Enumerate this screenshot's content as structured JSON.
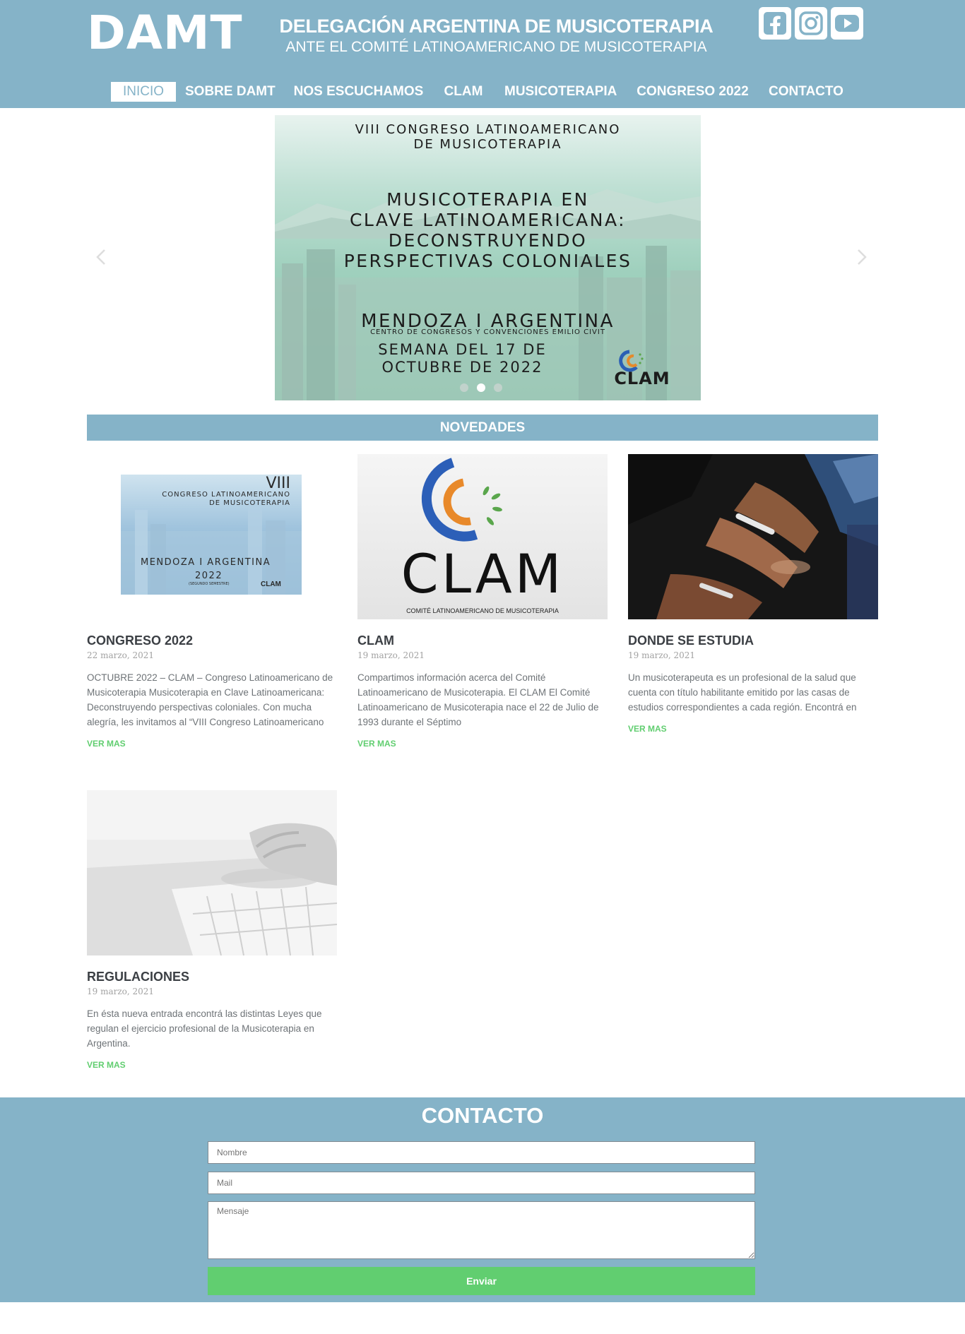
{
  "brand": {
    "logo_text": "DAMT",
    "title": "DELEGACIÓN ARGENTINA DE MUSICOTERAPIA",
    "subtitle": "ANTE EL COMITÉ LATINOAMERICANO DE MUSICOTERAPIA"
  },
  "social": [
    {
      "icon": "facebook-icon"
    },
    {
      "icon": "instagram-icon"
    },
    {
      "icon": "youtube-icon"
    }
  ],
  "nav": {
    "items": [
      {
        "label": "INICIO",
        "active": true
      },
      {
        "label": "SOBRE DAMT"
      },
      {
        "label": "NOS ESCUCHAMOS"
      },
      {
        "label": "CLAM"
      },
      {
        "label": "MUSICOTERAPIA"
      },
      {
        "label": "CONGRESO 2022"
      },
      {
        "label": "CONTACTO"
      }
    ]
  },
  "slider": {
    "top_line1": "VIII CONGRESO LATINOAMERICANO",
    "top_line2": "DE MUSICOTERAPIA",
    "main_line1": "MUSICOTERAPIA EN",
    "main_line2": "CLAVE LATINOAMERICANA:",
    "main_line3": "DECONSTRUYENDO",
    "main_line4": "PERSPECTIVAS COLONIALES",
    "city": "MENDOZA I ARGENTINA",
    "venue": "CENTRO DE CONGRESOS Y CONVENCIONES EMILIO CIVIT",
    "date_line1": "SEMANA DEL 17 DE",
    "date_line2": "OCTUBRE DE 2022",
    "badge": "CLAM",
    "prev_icon": "chevron-left-icon",
    "next_icon": "chevron-right-icon",
    "active_dot": 1
  },
  "novedades": {
    "heading": "NOVEDADES",
    "posts": [
      {
        "title": "CONGRESO 2022",
        "date": "22 marzo, 2021",
        "excerpt": "OCTUBRE 2022 – CLAM – Congreso Latinoamericano de Musicoterapia Musicoterapia en Clave Latinoamericana: Deconstruyendo perspectivas coloniales. Con mucha alegría, les invitamos al “VIII Congreso Latinoamericano",
        "more": "VER MAS",
        "thumb": {
          "numeral": "VIII",
          "line1": "CONGRESO LATINOAMERICANO",
          "line2": "DE MUSICOTERAPIA",
          "city": "MENDOZA I ARGENTINA",
          "year": "2022",
          "semester": "(SEGUNDO SEMESTRE)",
          "badge": "CLAM"
        }
      },
      {
        "title": "CLAM",
        "date": "19 marzo, 2021",
        "excerpt": "Compartimos información acerca del Comité Latinoamericano de Musicoterapia. El CLAM El Comité Latinoamericano de Musicoterapia nace el 22 de Julio de 1993 durante el Séptimo",
        "more": "VER MAS",
        "thumb": {
          "wordmark": "CLAM",
          "caption": "COMITÉ LATINOAMERICANO DE MUSICOTERAPIA"
        }
      },
      {
        "title": "DONDE SE ESTUDIA",
        "date": "19 marzo, 2021",
        "excerpt": "Un musicoterapeuta es un profesional de la salud que cuenta con título habilitante emitido por las casas de estudios correspondientes a cada región. Encontrá en",
        "more": "VER MAS"
      },
      {
        "title": "REGULACIONES",
        "date": "19 marzo, 2021",
        "excerpt": "En ésta nueva entrada encontrá las distintas Leyes que regulan el ejercicio profesional de la Musicoterapia en Argentina.",
        "more": "VER MAS"
      }
    ]
  },
  "contact": {
    "heading": "CONTACTO",
    "name_placeholder": "Nombre",
    "mail_placeholder": "Mail",
    "message_placeholder": "Mensaje",
    "submit_label": "Enviar"
  },
  "colors": {
    "primary": "#85b3c8",
    "accent": "#61ce70",
    "white": "#ffffff"
  }
}
